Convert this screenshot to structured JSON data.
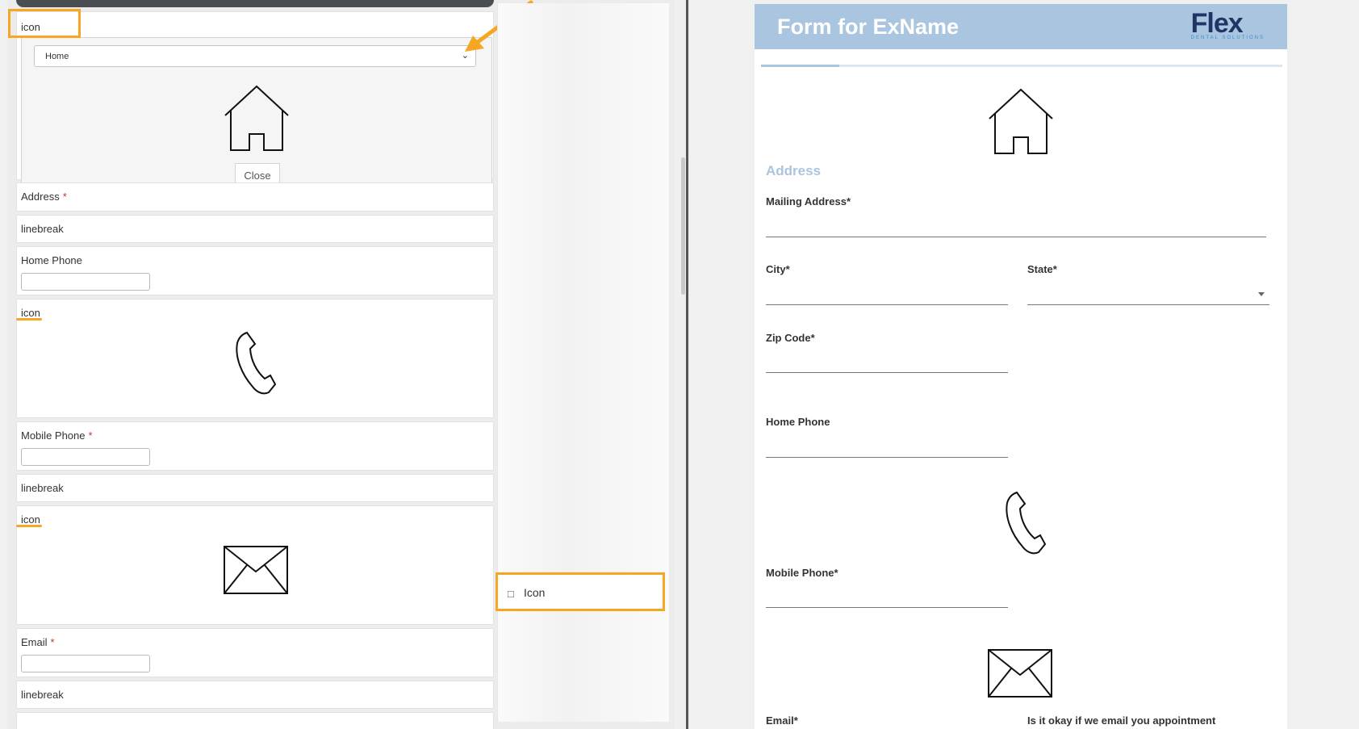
{
  "builder": {
    "icon_card": {
      "label": "icon",
      "select_value": "Home",
      "close_label": "Close"
    },
    "fields": [
      {
        "label": "Address",
        "required": "*"
      },
      {
        "label": "linebreak"
      },
      {
        "label": "Home Phone"
      },
      {
        "label": "icon"
      },
      {
        "label": "Mobile Phone",
        "required": "*"
      },
      {
        "label": "linebreak"
      },
      {
        "label": "icon"
      },
      {
        "label": "Email",
        "required": "*"
      },
      {
        "label": "linebreak"
      }
    ],
    "palette": {
      "item_label": "Icon",
      "item_icon": "file-icon"
    },
    "highlight_color": "#f5a623"
  },
  "preview": {
    "title": "Form for ExName",
    "logo_text": "Flex",
    "logo_sub": "DENTAL SOLUTIONS",
    "header_color": "#a9c5df",
    "progress": 0.15,
    "section": "Address",
    "fields": {
      "mailing_address": "Mailing Address",
      "city": "City",
      "state": "State",
      "zip": "Zip Code",
      "home_phone": "Home Phone",
      "mobile_phone": "Mobile Phone",
      "email": "Email",
      "email_ok": "Is it okay if we email you appointment"
    },
    "req": "*"
  }
}
